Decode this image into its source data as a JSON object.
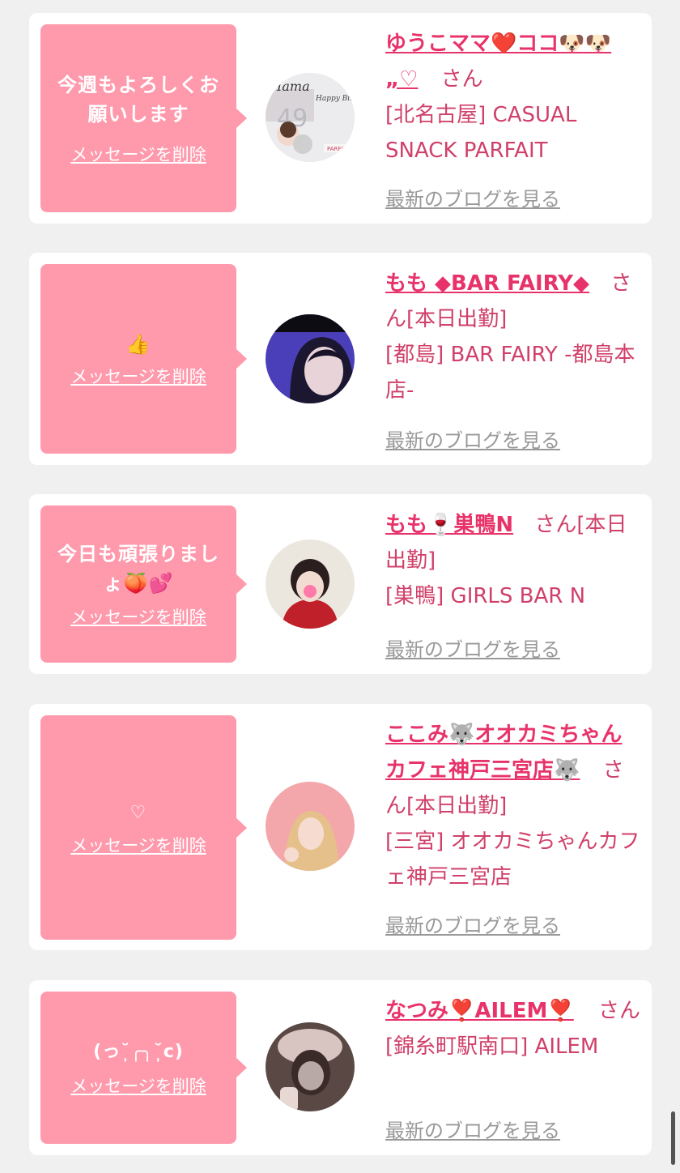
{
  "delete_label": "メッセージを削除",
  "blog_label": "最新のブログを見る",
  "san_label": "さん",
  "cards": [
    {
      "message": "今週もよろしくお\n願いします",
      "name": "ゆうこママ❤️ココ🐶🐶„♡",
      "suffix": "さん",
      "shop": "[北名古屋] CASUAL SNACK PARFAIT",
      "avatar_icon": "birthday-photo"
    },
    {
      "message": "👍",
      "name": "もも ◆BAR FAIRY◆",
      "suffix": "さん[本日出勤]",
      "shop": "[都島] BAR FAIRY -都島本店-",
      "avatar_icon": "portrait-photo"
    },
    {
      "message": "今日も頑張りまし\nょ🍑💕",
      "name": "もも🍷巣鴨N",
      "suffix": "さん[本日出勤]",
      "shop": "[巣鴨] GIRLS BAR N",
      "avatar_icon": "portrait-photo"
    },
    {
      "message": "♡",
      "name": "ここみ🐺オオカミちゃんカフェ神戸三宮店🐺",
      "suffix": "さん[本日出勤]",
      "shop": "[三宮] オオカミちゃんカフェ神戸三宮店",
      "avatar_icon": "portrait-photo"
    },
    {
      "message": "(っ˘̩╭╮˘̩c)",
      "name": "なつみ❣️AILEM❣️",
      "suffix": "さん",
      "shop": "[錦糸町駅南口] AILEM",
      "avatar_icon": "portrait-photo"
    }
  ]
}
